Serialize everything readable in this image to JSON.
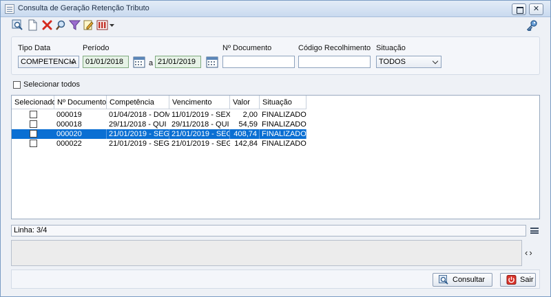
{
  "window": {
    "title": "Consulta de Geração Retenção Tributo"
  },
  "toolbar": {
    "items": [
      "search-icon",
      "new-document-icon",
      "delete-icon",
      "find-icon",
      "filter-icon",
      "edit-icon",
      "columns-icon",
      "dropdown-arrow-icon"
    ],
    "right_item": "key-icon"
  },
  "filters": {
    "tipo_data": {
      "label": "Tipo Data",
      "value": "COMPETENCIA"
    },
    "periodo": {
      "label": "Período",
      "from": "01/01/2018",
      "separator": "a",
      "to": "21/01/2019"
    },
    "documento": {
      "label": "Nº Documento",
      "value": ""
    },
    "codigo_recolhimento": {
      "label": "Código Recolhimento",
      "value": ""
    },
    "situacao": {
      "label": "Situação",
      "value": "TODOS"
    }
  },
  "select_all": {
    "label": "Selecionar todos",
    "checked": false
  },
  "table": {
    "columns": [
      "Selecionado",
      "Nº Documento",
      "Competência",
      "Vencimento",
      "Valor",
      "Situação"
    ],
    "rows": [
      {
        "documento": "000019",
        "competencia": "01/04/2018 - DOM",
        "vencimento": "11/01/2019 - SEX",
        "valor": "2,00",
        "situacao": "FINALIZADO",
        "selected": false
      },
      {
        "documento": "000018",
        "competencia": "29/11/2018 - QUI",
        "vencimento": "29/11/2018 - QUI",
        "valor": "54,59",
        "situacao": "FINALIZADO",
        "selected": false
      },
      {
        "documento": "000020",
        "competencia": "21/01/2019 - SEG",
        "vencimento": "21/01/2019 - SEG",
        "valor": "408,74",
        "situacao": "FINALIZADO",
        "selected": true
      },
      {
        "documento": "000022",
        "competencia": "21/01/2019 - SEG",
        "vencimento": "21/01/2019 - SEG",
        "valor": "142,84",
        "situacao": "FINALIZADO",
        "selected": false
      }
    ]
  },
  "status": {
    "text": "Linha: 3/4"
  },
  "nav": {
    "prev": "‹",
    "next": "›"
  },
  "buttons": {
    "consultar": "Consultar",
    "sair": "Sair"
  },
  "colors": {
    "selection": "#0a6fd3",
    "date_field": "#e6f2e6"
  }
}
